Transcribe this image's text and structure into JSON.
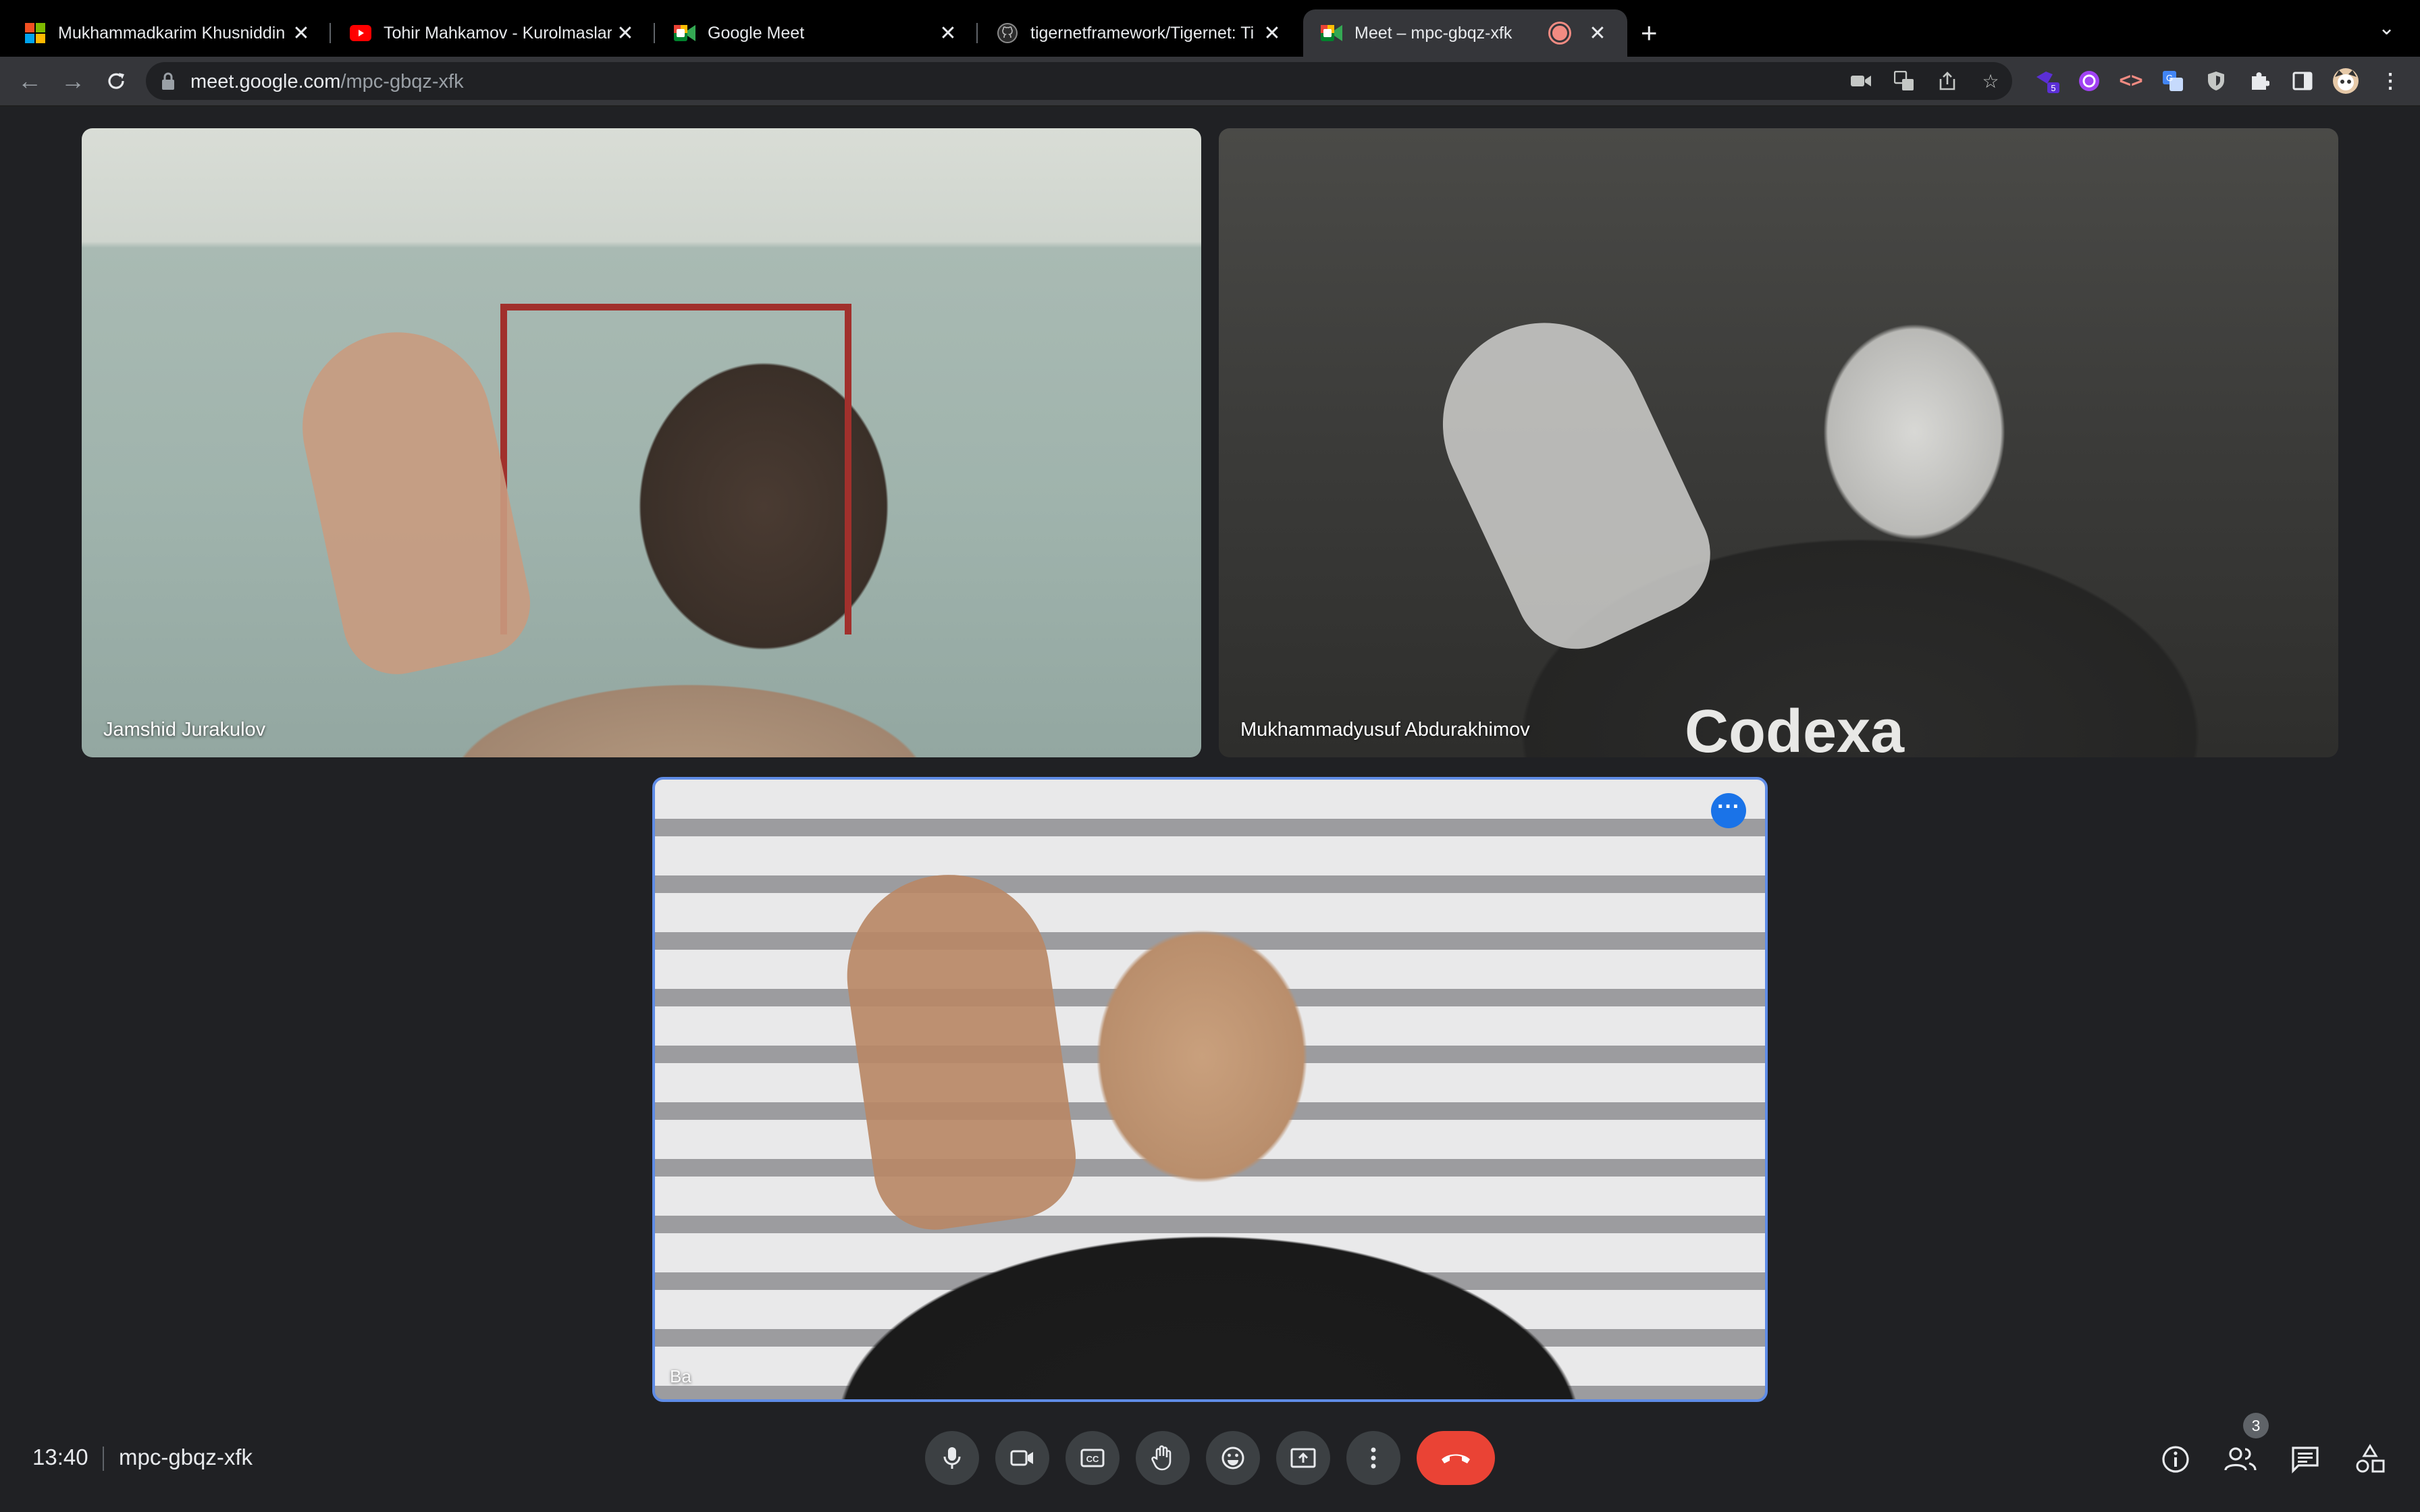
{
  "browser": {
    "tabs": [
      {
        "title": "Mukhammadkarim Khusniddin",
        "favicon": "microsoft-icon"
      },
      {
        "title": "Tohir Mahkamov - Kurolmaslar",
        "favicon": "youtube-icon"
      },
      {
        "title": "Google Meet",
        "favicon": "google-meet-icon"
      },
      {
        "title": "tigernetframework/Tigernet: Ti",
        "favicon": "github-icon"
      },
      {
        "title": "Meet – mpc-gbqz-xfk",
        "favicon": "google-meet-icon",
        "active": true,
        "recording": true
      }
    ],
    "new_tab_label": "+",
    "tab_menu_label": "⌄",
    "url_host": "meet.google.com",
    "url_path": "/mpc-gbqz-xfk",
    "extension_badge": "5"
  },
  "meet": {
    "participants": [
      {
        "name": "Jamshid Jurakulov"
      },
      {
        "name": "Mukhammadyusuf Abdurakhimov",
        "shirt_text": "Codexa"
      },
      {
        "name": "Ba",
        "pinned": true
      }
    ],
    "time": "13:40",
    "meeting_code": "mpc-gbqz-xfk",
    "participant_count": "3"
  },
  "colors": {
    "background": "#202124",
    "control": "#3c4043",
    "end_call": "#ea4335",
    "accent": "#1a73e8",
    "active_border": "#5f8ce6"
  }
}
